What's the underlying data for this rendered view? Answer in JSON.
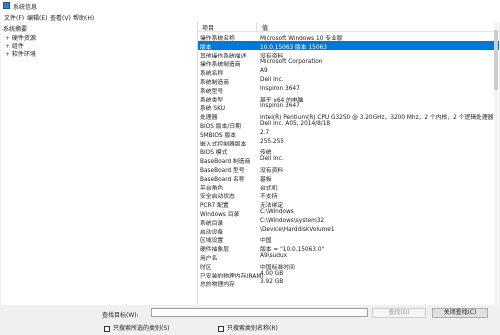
{
  "window": {
    "title": "系统信息"
  },
  "menu": [
    "文件(F)",
    "编辑(E)",
    "查看(V)",
    "帮助(H)"
  ],
  "tree": {
    "root": "系统摘要",
    "items": [
      {
        "expander": "+",
        "label": "硬件资源"
      },
      {
        "expander": "+",
        "label": "组件"
      },
      {
        "expander": "+",
        "label": "软件环境"
      }
    ]
  },
  "table": {
    "headers": [
      "项目",
      "值"
    ],
    "rows": [
      {
        "k": "操作系统名称",
        "v": "Microsoft Windows 10 专业版"
      },
      {
        "k": "版本",
        "v": "10.0.15063 版本 15063",
        "selected": true
      },
      {
        "k": "其他操作系统描述",
        "v": "没有资料"
      },
      {
        "k": "操作系统制造商",
        "v": "Microsoft Corporation"
      },
      {
        "k": "系统名称",
        "v": "A9"
      },
      {
        "k": "系统制造商",
        "v": "Dell Inc."
      },
      {
        "k": "系统型号",
        "v": "Inspiron 3647"
      },
      {
        "k": "系统类型",
        "v": "基于 x64 的电脑"
      },
      {
        "k": "系统 SKU",
        "v": "Inspiron 3647"
      },
      {
        "k": "处理器",
        "v": "Intel(R) Pentium(R) CPU G3250 @ 3.20GHz，3200 Mhz，2 个内核，2 个逻辑处理器"
      },
      {
        "k": "BIOS 版本/日期",
        "v": "Dell Inc. A05, 2014/8/18"
      },
      {
        "k": "SMBIOS 版本",
        "v": "2.7"
      },
      {
        "k": "嵌入式控制器版本",
        "v": "255.255"
      },
      {
        "k": "BIOS 模式",
        "v": "传统"
      },
      {
        "k": "BaseBoard 制造商",
        "v": "Dell Inc."
      },
      {
        "k": "BaseBoard 型号",
        "v": "没有资料"
      },
      {
        "k": "BaseBoard 名称",
        "v": "基板"
      },
      {
        "k": "平台角色",
        "v": "台式机"
      },
      {
        "k": "安全启动状态",
        "v": "不支持"
      },
      {
        "k": "PCR7 配置",
        "v": "无法绑定"
      },
      {
        "k": "Windows 目录",
        "v": "C:\\Windows"
      },
      {
        "k": "系统目录",
        "v": "C:\\Windows\\system32"
      },
      {
        "k": "启动设备",
        "v": "\\Device\\HarddiskVolume1"
      },
      {
        "k": "区域设置",
        "v": "中国"
      },
      {
        "k": "硬件抽象层",
        "v": "版本 = \"10.0.15063.0\""
      },
      {
        "k": "用户名",
        "v": "A9\\sudux"
      },
      {
        "k": "时区",
        "v": "中国标准时间"
      },
      {
        "k": "已安装的物理内存(RAM)",
        "v": "4.00 GB"
      },
      {
        "k": "总的物理内存",
        "v": "3.92 GB"
      }
    ]
  },
  "bottom": {
    "find_label": "查找目标(W):",
    "find_value": "",
    "find_button": "查找(D)",
    "close_find_button": "关闭查找(C)",
    "check1": "只搜索所选的类别(S)",
    "check2": "只搜索类别名称(R)"
  }
}
